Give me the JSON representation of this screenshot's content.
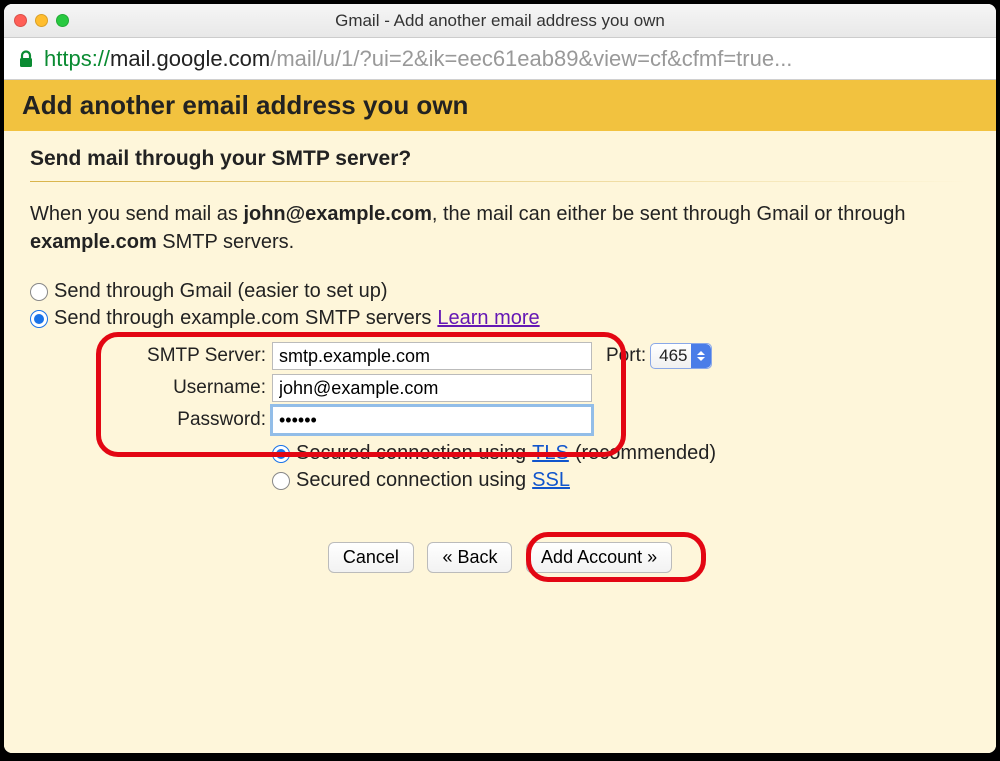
{
  "window": {
    "title": "Gmail - Add another email address you own"
  },
  "url": {
    "protocol": "https://",
    "host": "mail.google.com",
    "path": "/mail/u/1/?ui=2&ik=eec61eab89&view=cf&cfmf=true..."
  },
  "header": {
    "title": "Add another email address you own"
  },
  "subheader": "Send mail through your SMTP server?",
  "intro": {
    "prefix": "When you send mail as ",
    "email": "john@example.com",
    "middle": ", the mail can either be sent through Gmail or through ",
    "domain": "example.com",
    "suffix": " SMTP servers."
  },
  "radios": {
    "gmail": {
      "label": "Send through Gmail (easier to set up)",
      "checked": false
    },
    "smtp": {
      "prefix": "Send through ",
      "domain": "example.com",
      "suffix": " SMTP servers ",
      "learn_more": "Learn more",
      "checked": true
    }
  },
  "form": {
    "smtp_label": "SMTP Server:",
    "smtp_value": "smtp.example.com",
    "port_label": "Port:",
    "port_value": "465",
    "user_label": "Username:",
    "user_value": "john@example.com",
    "pass_label": "Password:",
    "pass_value": "••••••"
  },
  "security": {
    "tls": {
      "prefix": "Secured connection using ",
      "link": "TLS",
      "suffix": " (recommended)",
      "checked": true
    },
    "ssl": {
      "prefix": "Secured connection using ",
      "link": "SSL",
      "checked": false
    }
  },
  "buttons": {
    "cancel": "Cancel",
    "back": "« Back",
    "add": "Add Account »"
  }
}
